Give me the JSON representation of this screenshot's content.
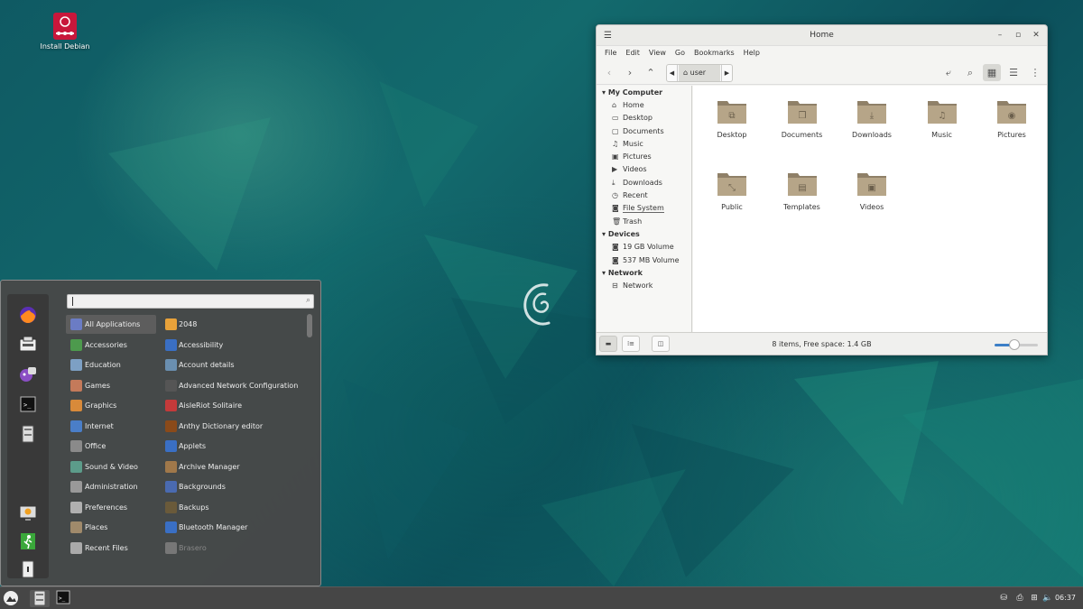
{
  "desktop": {
    "icons": [
      {
        "label": "Install Debian",
        "icon": "debian-installer-icon"
      }
    ]
  },
  "file_manager": {
    "title": "Home",
    "menu": [
      "File",
      "Edit",
      "View",
      "Go",
      "Bookmarks",
      "Help"
    ],
    "breadcrumb": "user",
    "sidebar": {
      "sections": [
        {
          "title": "My Computer",
          "items": [
            "Home",
            "Desktop",
            "Documents",
            "Music",
            "Pictures",
            "Videos",
            "Downloads",
            "Recent",
            "File System",
            "Trash"
          ]
        },
        {
          "title": "Devices",
          "items": [
            "19 GB Volume",
            "537 MB Volume"
          ]
        },
        {
          "title": "Network",
          "items": [
            "Network"
          ]
        }
      ]
    },
    "folders": [
      "Desktop",
      "Documents",
      "Downloads",
      "Music",
      "Pictures",
      "Public",
      "Templates",
      "Videos"
    ],
    "status": "8 items, Free space: 1.4 GB",
    "zoom_level": 0.45
  },
  "start_menu": {
    "categories": [
      "All Applications",
      "Accessories",
      "Education",
      "Games",
      "Graphics",
      "Internet",
      "Office",
      "Sound & Video",
      "Administration",
      "Preferences",
      "Places",
      "Recent Files"
    ],
    "apps": [
      "2048",
      "Accessibility",
      "Account details",
      "Advanced Network Configuration",
      "AisleRiot Solitaire",
      "Anthy Dictionary editor",
      "Applets",
      "Archive Manager",
      "Backgrounds",
      "Backups",
      "Bluetooth Manager",
      "Brasero"
    ],
    "selected_category": "All Applications",
    "favorites": [
      "firefox-icon",
      "software-manager-icon",
      "chat-icon",
      "terminal-icon",
      "file-cabinet-icon",
      "lock-screen-icon",
      "logout-icon",
      "shutdown-icon"
    ]
  },
  "panel": {
    "clock": "06:37",
    "accent": "#3c7fc7"
  }
}
